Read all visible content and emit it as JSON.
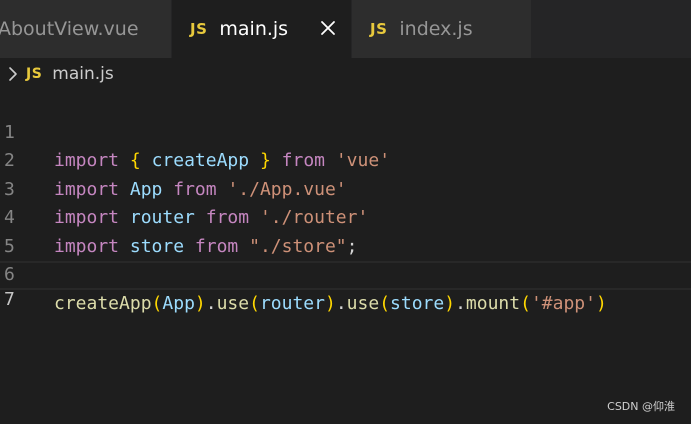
{
  "tabs": {
    "about": {
      "label": "AboutView.vue"
    },
    "main": {
      "icon": "JS",
      "label": "main.js"
    },
    "index": {
      "icon": "JS",
      "label": "index.js"
    }
  },
  "breadcrumb": {
    "icon": "JS",
    "file": "main.js"
  },
  "editor": {
    "lines": [
      {
        "num": "1",
        "tokens": [
          "import",
          " ",
          "{",
          " ",
          "createApp",
          " ",
          "}",
          " ",
          "from",
          " ",
          "'vue'"
        ]
      },
      {
        "num": "2",
        "tokens": [
          "import",
          " ",
          "App",
          " ",
          "from",
          " ",
          "'./App.vue'"
        ]
      },
      {
        "num": "3",
        "tokens": [
          "import",
          " ",
          "router",
          " ",
          "from",
          " ",
          "'./router'"
        ]
      },
      {
        "num": "4",
        "tokens": [
          "import",
          " ",
          "store",
          " ",
          "from",
          " ",
          "\"./store\"",
          ";"
        ]
      },
      {
        "num": "5",
        "tokens": []
      },
      {
        "num": "6",
        "tokens": [
          "createApp",
          "(",
          "App",
          ")",
          ".",
          "use",
          "(",
          "router",
          ")",
          ".",
          "use",
          "(",
          "store",
          ")",
          ".",
          "mount",
          "(",
          "'#app'",
          ")"
        ]
      },
      {
        "num": "7",
        "tokens": []
      }
    ],
    "current_line": "7"
  },
  "watermark": "CSDN @仰淮",
  "colors": {
    "keyword": "#c586c0",
    "identifier": "#9cdcfe",
    "function": "#dcdcaa",
    "string": "#ce9178",
    "js_icon": "#e8c93c"
  }
}
